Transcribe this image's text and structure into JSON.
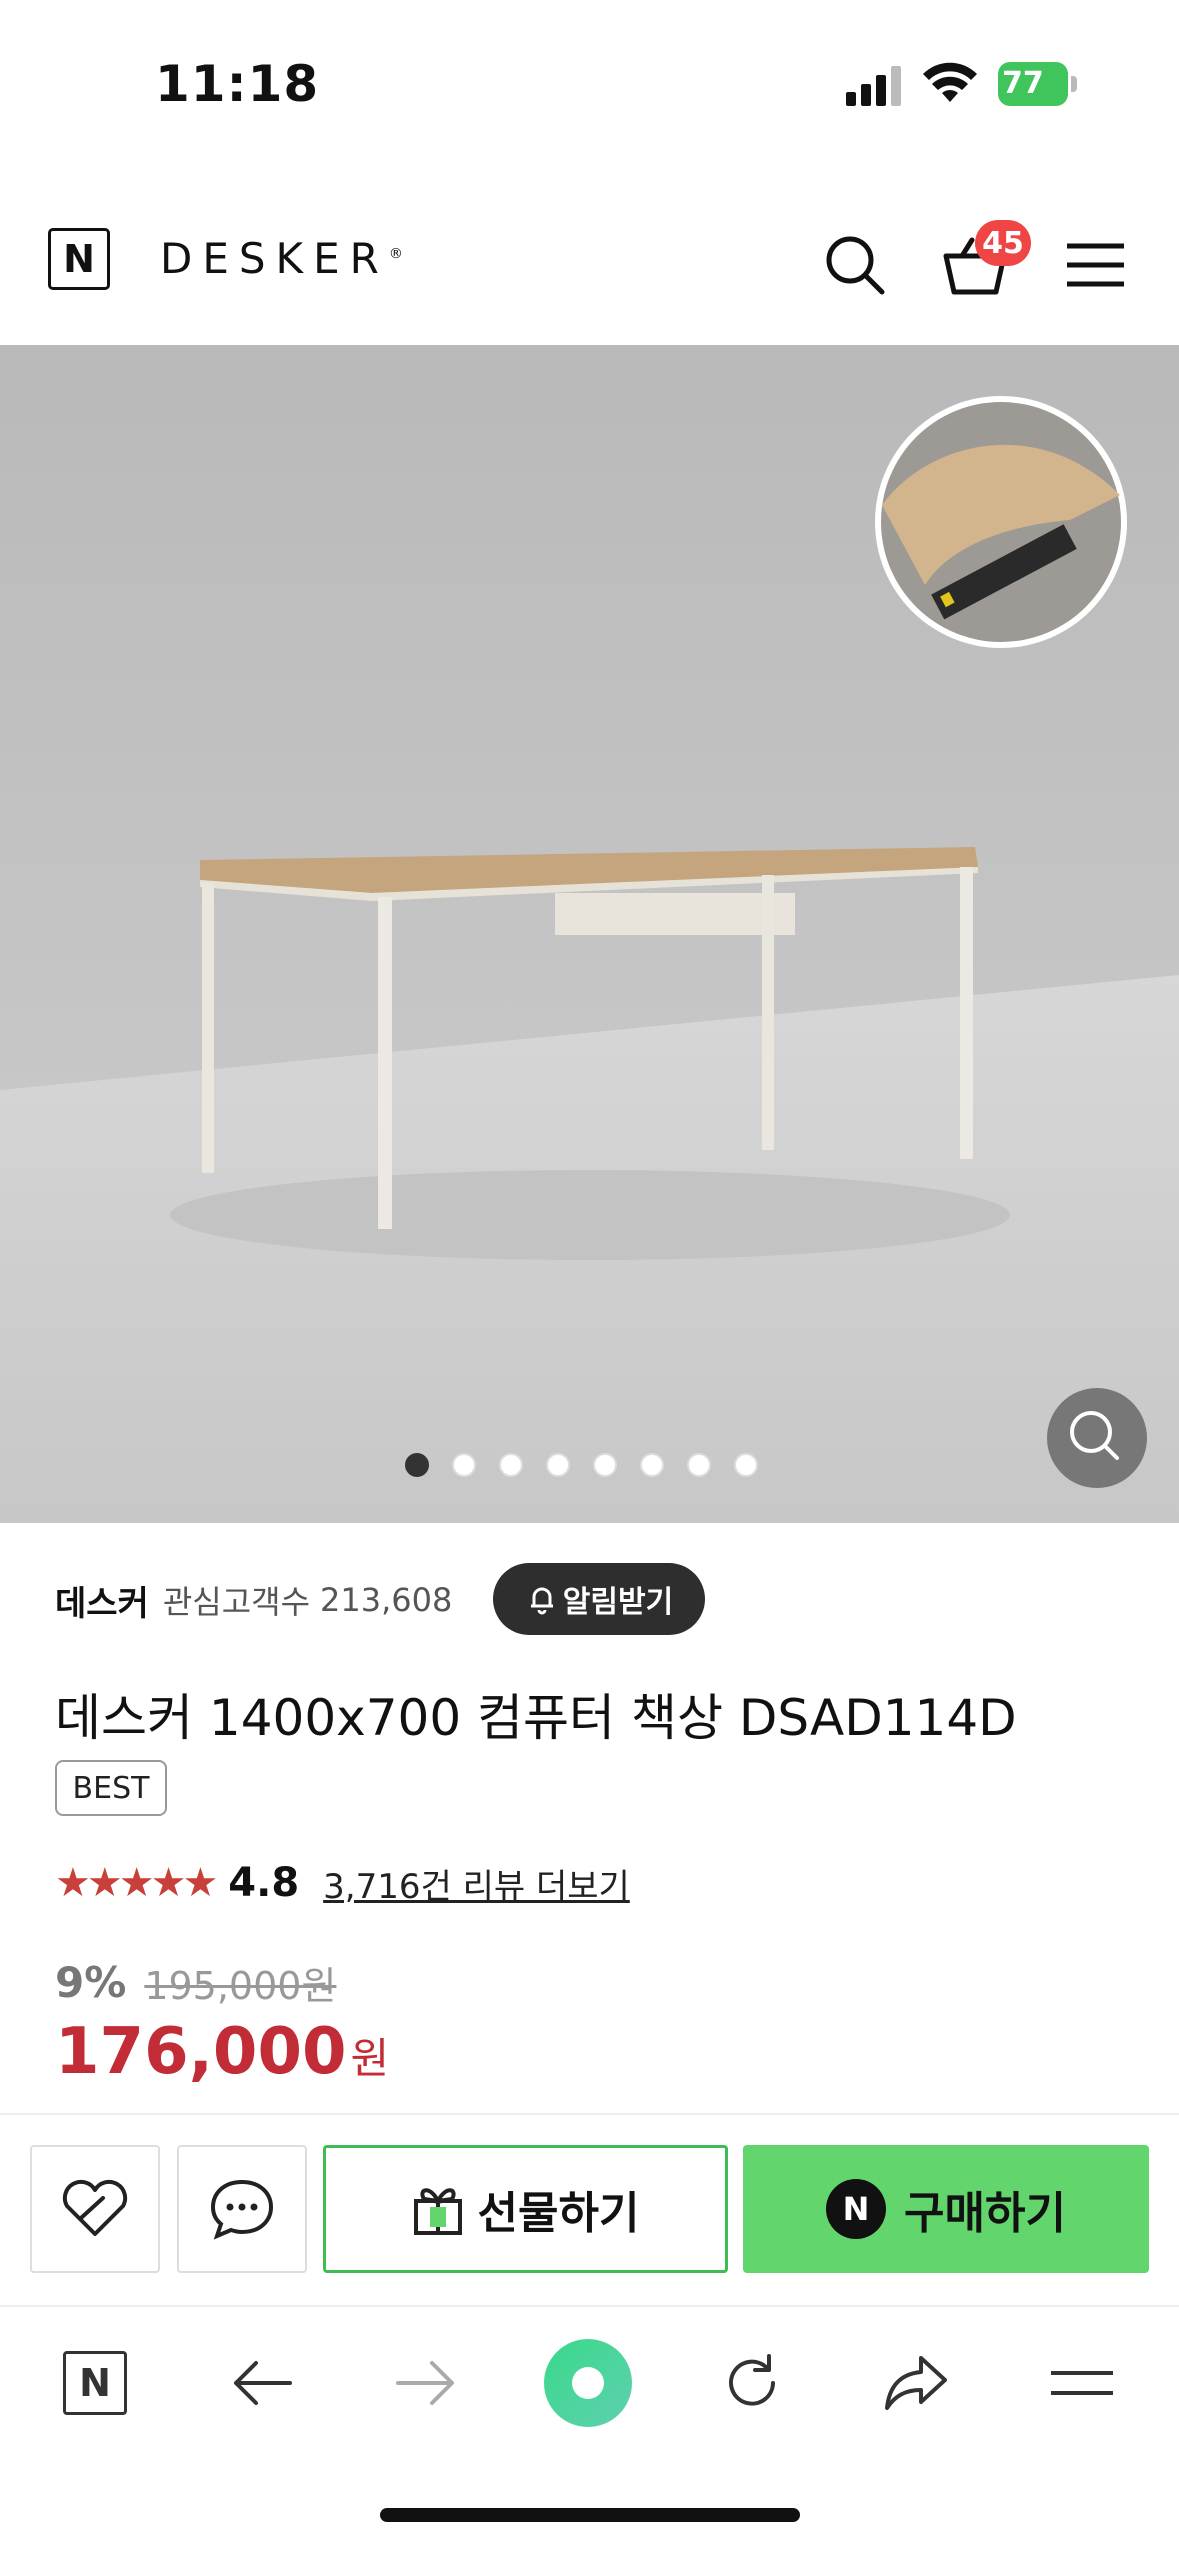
{
  "status_bar": {
    "time": "11:18",
    "battery_percent": "77"
  },
  "header": {
    "logo_letter": "N",
    "brand": "DESKER",
    "brand_mark": "®",
    "cart_count": "45"
  },
  "gallery": {
    "slide_count": 8,
    "active_index": 0
  },
  "product": {
    "seller": "데스커",
    "fans_label": "관심고객수",
    "fans_count": "213,608",
    "alarm_label": "알림받기",
    "title": "데스커 1400x700 컴퓨터 책상 DSAD114D",
    "badge": "BEST",
    "rating": "4.8",
    "stars": "★★★★★",
    "reviews_link": "3,716건 리뷰 더보기",
    "discount": "9%",
    "original_price": "195,000원",
    "price": "176,000",
    "currency": "원"
  },
  "actions": {
    "gift_label": "선물하기",
    "buy_label": "구매하기",
    "pay_letter": "N"
  },
  "toolbar": {
    "home_letter": "N"
  },
  "colors": {
    "price_red": "#c22c36",
    "star_red": "#c9403b",
    "naver_green": "#62d66c",
    "badge_red": "#ef4545"
  }
}
